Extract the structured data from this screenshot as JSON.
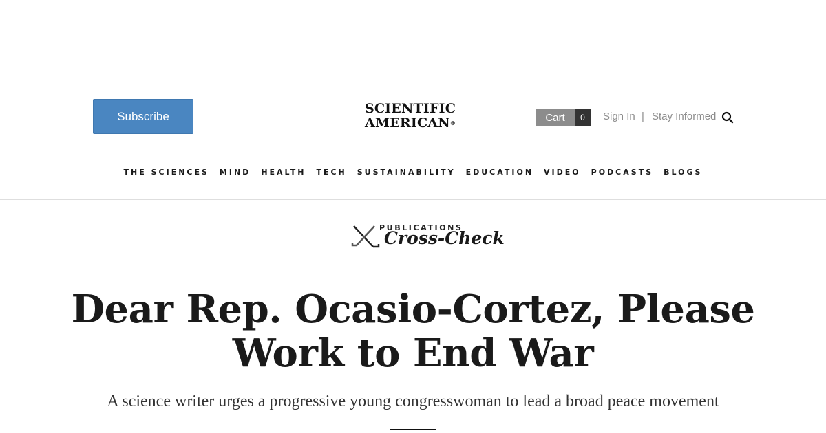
{
  "header": {
    "subscribe_label": "Subscribe",
    "logo_line1": "SCIENTIFIC",
    "logo_line2": "AMERICAN",
    "logo_reg": "®",
    "cart_label": "Cart",
    "cart_count": "0",
    "sign_in": "Sign In",
    "separator": "|",
    "stay_informed": "Stay Informed",
    "search_icon": "search-icon"
  },
  "nav": {
    "items": [
      "THE SCIENCES",
      "MIND",
      "HEALTH",
      "TECH",
      "SUSTAINABILITY",
      "EDUCATION",
      "VIDEO",
      "PODCASTS",
      "BLOGS"
    ]
  },
  "blog": {
    "publications": "PUBLICATIONS",
    "name": "Cross-Check",
    "icon": "crossed-hockey-sticks-icon"
  },
  "article": {
    "title": "Dear Rep. Ocasio-Cortez, Please Work to End War",
    "subtitle": "A science writer urges a progressive young congresswoman to lead a broad peace movement"
  },
  "colors": {
    "subscribe_bg": "#4a86c1",
    "cart_bg": "#8c8c8c",
    "cart_count_bg": "#333333",
    "link_gray": "#8c8c8c"
  }
}
